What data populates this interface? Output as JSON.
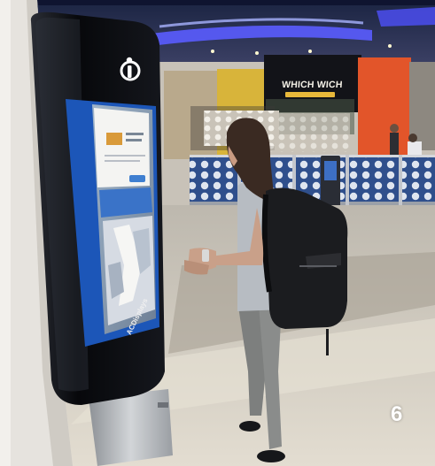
{
  "scene": {
    "caption_number": "6",
    "store_sign": "WHICH WICH",
    "kiosk_brand": "ACDisplays",
    "kiosk_logo": "info-i-icon",
    "colors": {
      "ceiling_glow": "#5a5cff",
      "kiosk_body": "#0d0f14",
      "screen_frame": "#1c56b8",
      "screen_map": "#7f8fa8",
      "wall_orange": "#e2552a",
      "fence_blue": "#2f4f8c",
      "backpack": "#1b1c1f",
      "floor": "#d8d2c6"
    }
  }
}
